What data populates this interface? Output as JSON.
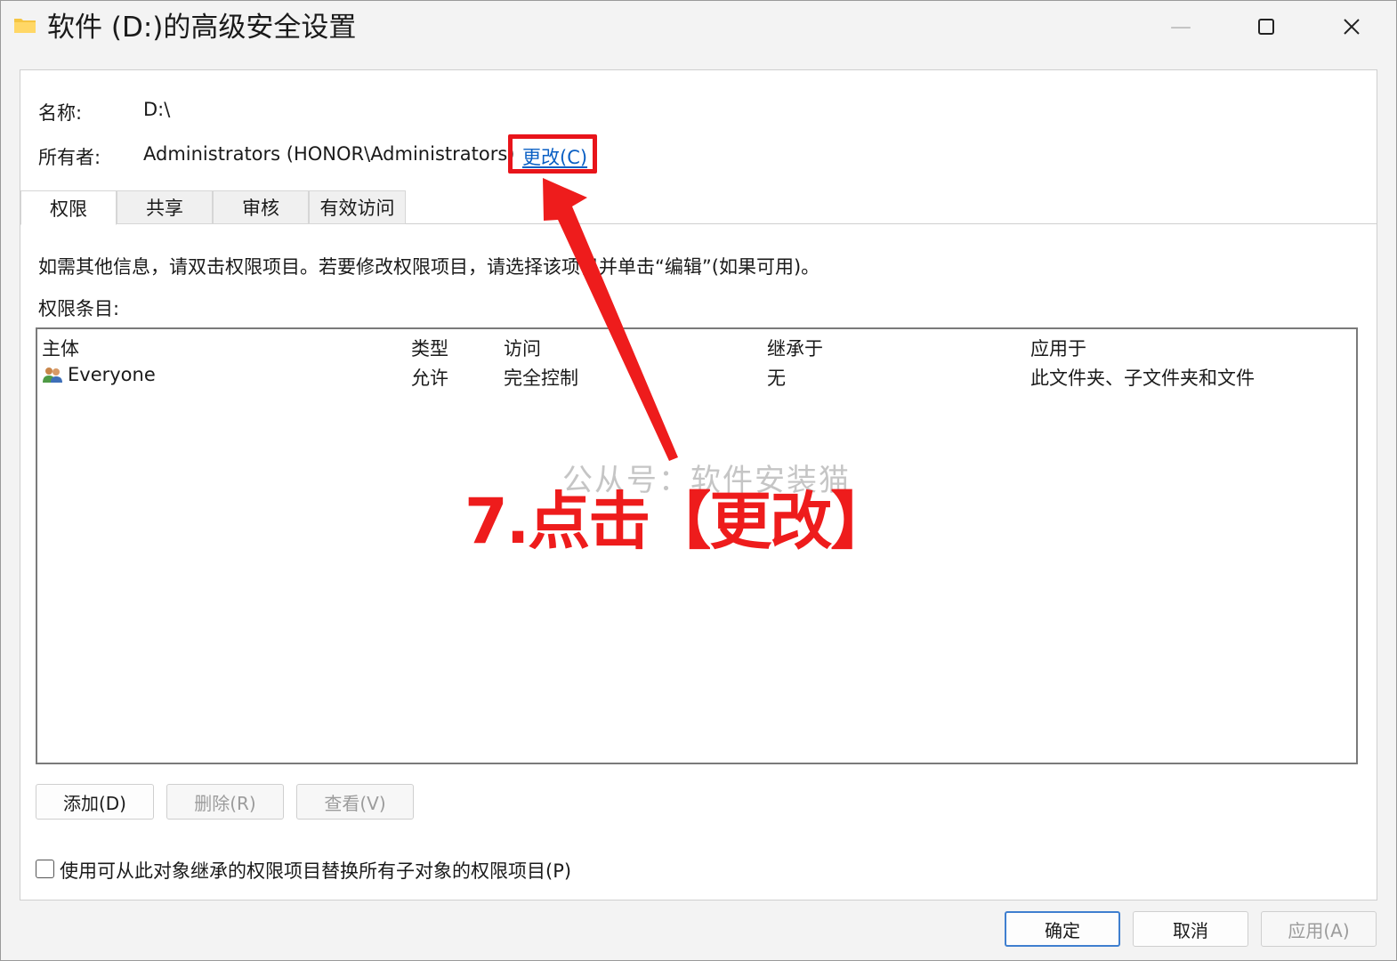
{
  "window": {
    "title": "软件 (D:)的高级安全设置",
    "minimize_icon": "minimize-icon",
    "maximize_icon": "maximize-icon",
    "close_icon": "close-icon"
  },
  "info": {
    "name_label": "名称:",
    "name_value": "D:\\",
    "owner_label": "所有者:",
    "owner_value": "Administrators (HONOR\\Administrators)",
    "change_link": "更改(C)"
  },
  "tabs": [
    {
      "label": "权限",
      "active": true
    },
    {
      "label": "共享",
      "active": false
    },
    {
      "label": "审核",
      "active": false
    },
    {
      "label": "有效访问",
      "active": false
    }
  ],
  "permissions": {
    "description": "如需其他信息，请双击权限项目。若要修改权限项目，请选择该项目并单击“编辑”(如果可用)。",
    "entries_label": "权限条目:",
    "columns": [
      "主体",
      "类型",
      "访问",
      "继承于",
      "应用于"
    ],
    "rows": [
      {
        "principal": "Everyone",
        "type": "允许",
        "access": "完全控制",
        "inherited_from": "无",
        "applies_to": "此文件夹、子文件夹和文件",
        "icon": "users-icon"
      }
    ]
  },
  "buttons": {
    "add": "添加(D)",
    "remove": "删除(R)",
    "view": "查看(V)"
  },
  "replace_checkbox": {
    "label": "使用可从此对象继承的权限项目替换所有子对象的权限项目(P)",
    "checked": false
  },
  "footer": {
    "ok": "确定",
    "cancel": "取消",
    "apply": "应用(A)"
  },
  "overlay": {
    "watermark": "公从号：软件安装猫",
    "instruction": "7.点击【更改】",
    "highlight_color": "#e8141a"
  }
}
